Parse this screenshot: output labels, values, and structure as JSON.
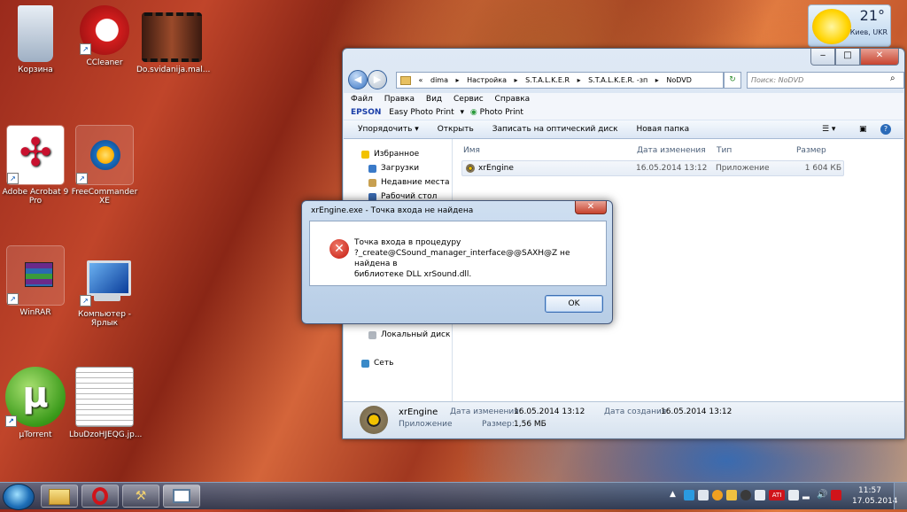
{
  "desktop": {
    "icons": [
      {
        "label": "Корзина"
      },
      {
        "label": "CCleaner"
      },
      {
        "label": "Do.svidanija.mal..."
      },
      {
        "label": "Adobe Acrobat 9 Pro"
      },
      {
        "label": "FreeCommander XE"
      },
      {
        "label": "WinRAR"
      },
      {
        "label": "Компьютер - Ярлык"
      },
      {
        "label": "µTorrent"
      },
      {
        "label": "LbuDzoHJEQG.jp..."
      }
    ]
  },
  "weather": {
    "temp": "21°",
    "city": "Киев, UKR"
  },
  "explorer": {
    "address": [
      "«",
      "dima",
      "▸",
      "Настройка",
      "▸",
      "S.T.A.L.K.E.R",
      "▸",
      "S.T.A.L.K.E.R. -зп",
      "▸",
      "NoDVD"
    ],
    "search_placeholder": "Поиск: NoDVD",
    "menu": [
      "Файл",
      "Правка",
      "Вид",
      "Сервис",
      "Справка"
    ],
    "epson": {
      "brand": "EPSON",
      "easy": "Easy Photo Print",
      "photo": "Photo Print"
    },
    "toolbar": [
      "Упорядочить ▾",
      "Открыть",
      "Записать на оптический диск",
      "Новая папка"
    ],
    "nav": [
      {
        "label": "Избранное"
      },
      {
        "label": "Загрузки"
      },
      {
        "label": "Недавние места"
      },
      {
        "label": "Рабочий стол"
      },
      {
        "label": "Локальный диск (D"
      },
      {
        "label": "Сеть"
      }
    ],
    "columns": {
      "name": "Имя",
      "date": "Дата изменения",
      "type": "Тип",
      "size": "Размер"
    },
    "file": {
      "name": "xrEngine",
      "date": "16.05.2014 13:12",
      "type": "Приложение",
      "size": "1 604 КБ"
    },
    "details": {
      "name": "xrEngine",
      "kind": "Приложение",
      "mod_label": "Дата изменения:",
      "mod_value": "16.05.2014 13:12",
      "size_label": "Размер:",
      "size_value": "1,56 МБ",
      "created_label": "Дата создания:",
      "created_value": "16.05.2014 13:12"
    }
  },
  "dialog": {
    "title": "xrEngine.exe - Точка входа не найдена",
    "line1": "Точка входа в процедуру",
    "line2": "?_create@CSound_manager_interface@@SAXH@Z не найдена в",
    "line3": "библиотеке DLL xrSound.dll.",
    "ok": "OK"
  },
  "clock": {
    "time": "11:57",
    "date": "17.05.2014"
  }
}
